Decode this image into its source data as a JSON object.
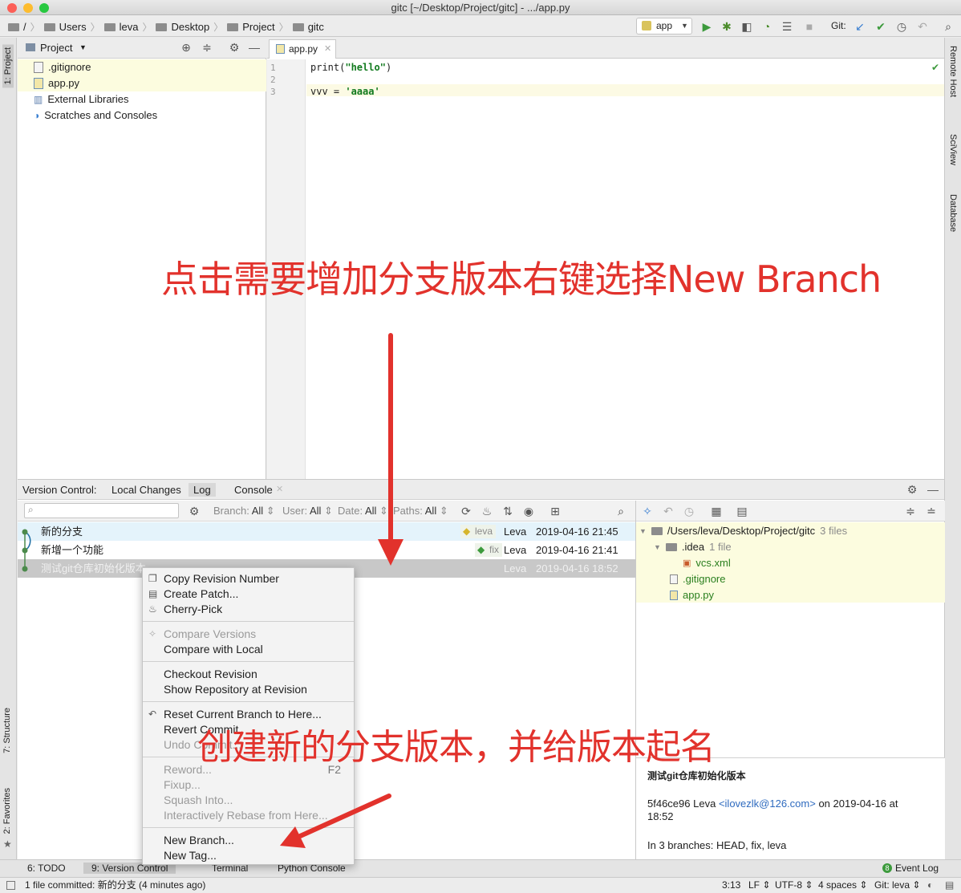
{
  "window": {
    "title": "gitc [~/Desktop/Project/gitc] - .../app.py"
  },
  "breadcrumb": [
    "/",
    "Users",
    "leva",
    "Desktop",
    "Project",
    "gitc"
  ],
  "run_config": "app",
  "git_label": "Git:",
  "left_stripe": {
    "project_tab": "1: Project",
    "structure_tab": "7: Structure",
    "favorites_tab": "2: Favorites"
  },
  "right_stripe": [
    "Remote Host",
    "SciView",
    "Database"
  ],
  "project_panel": {
    "title": "Project",
    "items": [
      ".gitignore",
      "app.py",
      "External Libraries",
      "Scratches and Consoles"
    ]
  },
  "editor": {
    "tab": "app.py",
    "lines": [
      {
        "n": "1",
        "pre": "print(",
        "str": "\"hello\"",
        "post": ")"
      },
      {
        "n": "2",
        "pre": "",
        "str": "",
        "post": ""
      },
      {
        "n": "3",
        "pre": "vvv = ",
        "str": "'aaaa'",
        "post": ""
      }
    ]
  },
  "vc": {
    "label": "Version Control:",
    "tabs": [
      "Local Changes",
      "Log",
      "Console"
    ],
    "filters": [
      {
        "label": "Branch:",
        "value": "All"
      },
      {
        "label": "User:",
        "value": "All"
      },
      {
        "label": "Date:",
        "value": "All"
      },
      {
        "label": "Paths:",
        "value": "All"
      }
    ],
    "commits": [
      {
        "message": "新的分支",
        "tag": "leva",
        "author": "Leva",
        "date": "2019-04-16 21:45"
      },
      {
        "message": "新增一个功能",
        "tag": "fix",
        "author": "Leva",
        "date": "2019-04-16 21:41"
      },
      {
        "message": "测试git仓库初始化版本",
        "tag": "",
        "author": "Leva",
        "date": "2019-04-16 18:52"
      }
    ],
    "changes": {
      "root": "/Users/leva/Desktop/Project/gitc",
      "root_count": "3 files",
      "idea": ".idea",
      "idea_count": "1 file",
      "files": [
        "vcs.xml",
        ".gitignore",
        "app.py"
      ]
    },
    "details": {
      "subject": "测试git仓库初始化版本",
      "hash": "5f46ce96",
      "author": "Leva",
      "email": "<ilovezlk@126.com>",
      "on": "on 2019-04-16 at",
      "time": "18:52",
      "branches": "In 3 branches: HEAD, fix, leva"
    }
  },
  "context_menu": {
    "groups": [
      [
        {
          "label": "Copy Revision Number",
          "enabled": true,
          "icon": "copy-icon"
        },
        {
          "label": "Create Patch...",
          "enabled": true,
          "icon": "patch-icon"
        },
        {
          "label": "Cherry-Pick",
          "enabled": true,
          "icon": "cherry-icon"
        }
      ],
      [
        {
          "label": "Compare Versions",
          "enabled": false,
          "icon": "compare-icon"
        },
        {
          "label": "Compare with Local",
          "enabled": true,
          "icon": ""
        }
      ],
      [
        {
          "label": "Checkout Revision",
          "enabled": true,
          "icon": ""
        },
        {
          "label": "Show Repository at Revision",
          "enabled": true,
          "icon": ""
        }
      ],
      [
        {
          "label": "Reset Current Branch to Here...",
          "enabled": true,
          "icon": "reset-icon"
        },
        {
          "label": "Revert Commit",
          "enabled": true,
          "icon": ""
        },
        {
          "label": "Undo Commit...",
          "enabled": false,
          "icon": ""
        }
      ],
      [
        {
          "label": "Reword...",
          "enabled": false,
          "icon": "",
          "shortcut": "F2"
        },
        {
          "label": "Fixup...",
          "enabled": false,
          "icon": ""
        },
        {
          "label": "Squash Into...",
          "enabled": false,
          "icon": ""
        },
        {
          "label": "Interactively Rebase from Here...",
          "enabled": false,
          "icon": ""
        }
      ],
      [
        {
          "label": "New Branch...",
          "enabled": true,
          "icon": ""
        },
        {
          "label": "New Tag...",
          "enabled": true,
          "icon": ""
        }
      ]
    ]
  },
  "bottom_tabs": [
    "6: TODO",
    "9: Version Control",
    "Terminal",
    "Python Console"
  ],
  "event_log": {
    "count": "8",
    "label": "Event Log"
  },
  "status": {
    "message": "1 file committed: 新的分支 (4 minutes ago)",
    "position": "3:13",
    "line_sep": "LF",
    "encoding": "UTF-8",
    "indent": "4 spaces",
    "branch": "Git: leva"
  },
  "annotations": {
    "top": "点击需要增加分支版本右键选择New Branch",
    "bottom": "创建新的分支版本，并给版本起名"
  },
  "colors": {
    "annotation": "#e2322c",
    "selection": "#e4f3fb",
    "changes_bg": "#fcfcdf",
    "accent": "#2a7f1e"
  }
}
